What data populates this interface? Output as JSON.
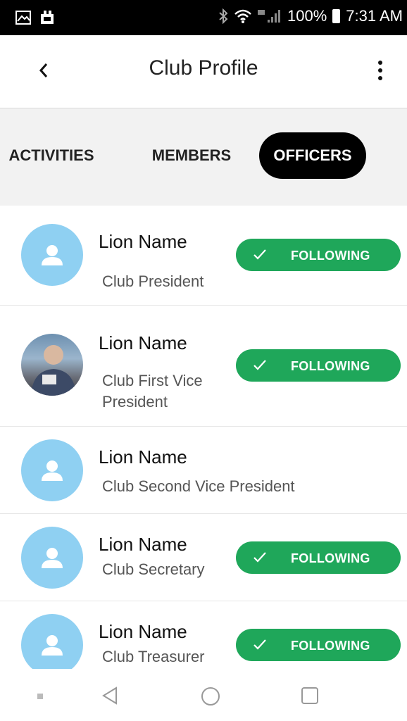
{
  "status_bar": {
    "battery": "100%",
    "time": "7:31 AM",
    "left_icons": [
      "gallery-icon",
      "notification-icon"
    ],
    "right_icons": [
      "bluetooth-icon",
      "wifi-icon",
      "signal-icon",
      "battery-icon"
    ]
  },
  "header": {
    "title": "Club Profile",
    "back_icon": "chevron-left-icon",
    "menu_icon": "more-vertical-icon"
  },
  "tabs": [
    {
      "label": "ACTIVITIES",
      "active": false
    },
    {
      "label": "MEMBERS",
      "active": false
    },
    {
      "label": "OFFICERS",
      "active": true
    }
  ],
  "officers": [
    {
      "name": "Lion Name",
      "role": "Club President",
      "avatar": "person-placeholder",
      "following": true,
      "button_label": "FOLLOWING"
    },
    {
      "name": "Lion Name",
      "role_line1": "Club First Vice",
      "role_line2": "President",
      "avatar": "photo",
      "following": true,
      "button_label": "FOLLOWING"
    },
    {
      "name": "Lion Name",
      "role": "Club Second Vice President",
      "avatar": "person-placeholder",
      "following": false
    },
    {
      "name": "Lion Name",
      "role": "Club Secretary",
      "avatar": "person-placeholder",
      "following": true,
      "button_label": "FOLLOWING"
    },
    {
      "name": "Lion Name",
      "role": "Club Treasurer",
      "avatar": "person-placeholder",
      "following": true,
      "button_label": "FOLLOWING"
    }
  ],
  "colors": {
    "accent_green": "#1fa75a",
    "avatar_blue": "#8fd0f2",
    "active_tab": "#000000",
    "tab_strip_bg": "#f2f2f2"
  },
  "nav_bar": {
    "items": [
      "recent-dot-icon",
      "back-triangle-icon",
      "home-circle-icon",
      "overview-square-icon"
    ]
  }
}
